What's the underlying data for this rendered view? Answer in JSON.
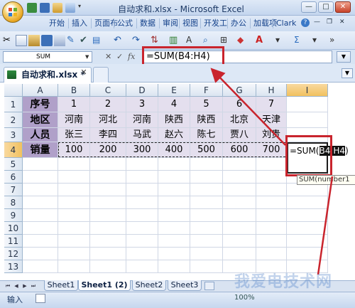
{
  "window": {
    "title": "自动求和.xlsx - Microsoft Excel",
    "min": "—",
    "max": "□",
    "close": "✕"
  },
  "ribbon_tabs": [
    "开始",
    "插入",
    "页面布",
    "公式",
    "数据",
    "审阅",
    "视图",
    "开发工",
    "办公",
    "加载项",
    "Clark"
  ],
  "formula_bar": {
    "name_box": "SUM",
    "cancel": "✕",
    "enter": "✓",
    "fx": "fx",
    "formula": "=SUM(B4:H4)",
    "expand": "▼"
  },
  "workbook_tab": {
    "label": "自动求和.xlsx *",
    "close": "✕",
    "menu": "▼"
  },
  "columns": [
    "A",
    "B",
    "C",
    "D",
    "E",
    "F",
    "G",
    "H",
    "I"
  ],
  "rows": [
    "1",
    "2",
    "3",
    "4",
    "5",
    "6",
    "7",
    "8",
    "9",
    "10",
    "11",
    "12",
    "13"
  ],
  "table": {
    "r1": [
      "序号",
      "1",
      "2",
      "3",
      "4",
      "5",
      "6",
      "7"
    ],
    "r2": [
      "地区",
      "河南",
      "河北",
      "河南",
      "陕西",
      "陕西",
      "北京",
      "天津"
    ],
    "r3": [
      "人员",
      "张三",
      "李四",
      "马武",
      "赵六",
      "陈七",
      "贾八",
      "刘贵"
    ],
    "r4": [
      "销量",
      "100",
      "200",
      "300",
      "400",
      "500",
      "600",
      "700"
    ]
  },
  "editing_cell": {
    "prefix": "=SUM(",
    "selected": "B4:H4",
    "suffix": ")",
    "tooltip": "SUM(number1"
  },
  "sheets": [
    "Sheet1",
    "Sheet1 (2)",
    "Sheet2",
    "Sheet3"
  ],
  "active_sheet": "Sheet1 (2)",
  "status": {
    "mode": "输入",
    "zoom": "100%"
  },
  "watermark": "我爱电技术网",
  "colors": {
    "header_fill": "#b0a0c9",
    "data_fill": "#e4dfee",
    "annotation": "#c9242d"
  }
}
